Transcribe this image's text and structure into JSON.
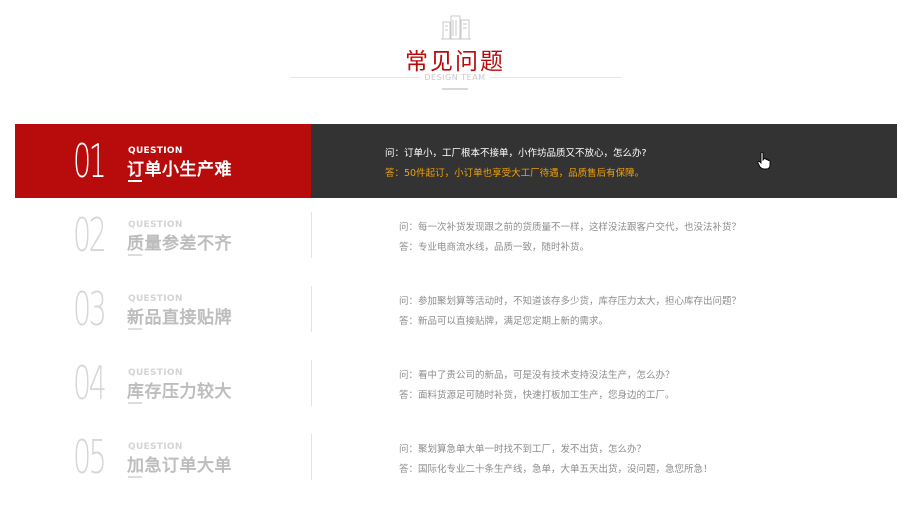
{
  "header": {
    "title": "常见问题",
    "subtitle": "DESIGN TEAM",
    "icon": "buildings-icon"
  },
  "colors": {
    "accent": "#b80b0b",
    "dark_panel": "#333333",
    "answer_highlight": "#f0a10a"
  },
  "faq": [
    {
      "num": "01",
      "label": "QUESTION",
      "title": "订单小生产难",
      "q": "问：订单小，工厂根本不接单，小作坊品质又不放心，怎么办?",
      "a": "答：50件起订，小订单也享受大工厂待遇，品质售后有保障。",
      "active": true
    },
    {
      "num": "02",
      "label": "QUESTION",
      "title": "质量参差不齐",
      "q": "问：每一次补货发现跟之前的货质量不一样，这样没法跟客户交代，也没法补货？",
      "a": "答：专业电商流水线，品质一致，随时补货。",
      "active": false
    },
    {
      "num": "03",
      "label": "QUESTION",
      "title": "新品直接贴牌",
      "q": "问：参加聚划算等活动时，不知道该存多少货，库存压力太大，担心库存出问题？",
      "a": "答：新品可以直接贴牌，满足您定期上新的需求。",
      "active": false
    },
    {
      "num": "04",
      "label": "QUESTION",
      "title": "库存压力较大",
      "q": "问：看中了贵公司的新品，可是没有技术支持没法生产，怎么办？",
      "a": "答：面料货源足可随时补货，快速打板加工生产，您身边的工厂。",
      "active": false
    },
    {
      "num": "05",
      "label": "QUESTION",
      "title": "加急订单大单",
      "q": "问：聚划算急单大单一时找不到工厂，发不出货，怎么办？",
      "a": "答：国际化专业二十条生产线，急单，大单五天出货，没问题，急您所急！",
      "active": false
    }
  ]
}
